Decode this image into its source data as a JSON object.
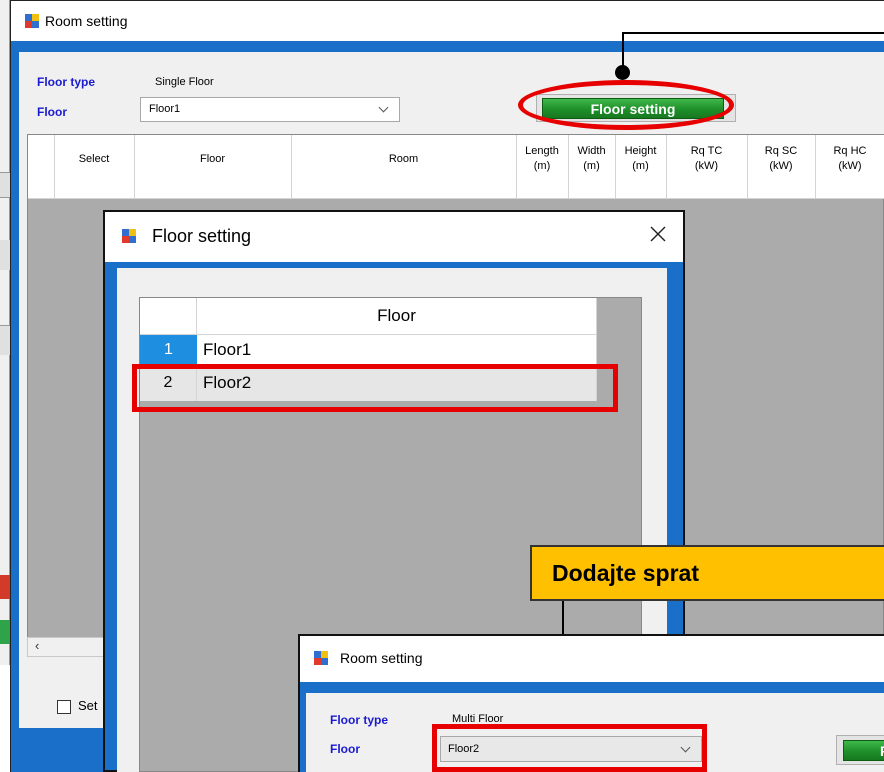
{
  "main_window": {
    "title": "Room setting",
    "floor_type_label": "Floor type",
    "floor_type_value": "Single Floor",
    "floor_label": "Floor",
    "floor_value": "Floor1",
    "floor_setting_button": "Floor setting",
    "columns": [
      {
        "line1": "Select",
        "line2": ""
      },
      {
        "line1": "Floor",
        "line2": ""
      },
      {
        "line1": "Room",
        "line2": ""
      },
      {
        "line1": "Length",
        "line2": "(m)"
      },
      {
        "line1": "Width",
        "line2": "(m)"
      },
      {
        "line1": "Height",
        "line2": "(m)"
      },
      {
        "line1": "Rq TC",
        "line2": "(kW)"
      },
      {
        "line1": "Rq SC",
        "line2": "(kW)"
      },
      {
        "line1": "Rq HC",
        "line2": "(kW)"
      }
    ],
    "checkbox_label": "Set"
  },
  "floor_dialog": {
    "title": "Floor setting",
    "column_header": "Floor",
    "rows": [
      {
        "num": "1",
        "name": "Floor1",
        "selected": true
      },
      {
        "num": "2",
        "name": "Floor2",
        "selected": false
      }
    ]
  },
  "callout": {
    "text": "Dodajte sprat",
    "bg_color": "#ffc000"
  },
  "second_window": {
    "title": "Room setting",
    "floor_type_label": "Floor type",
    "floor_type_value": "Multi Floor",
    "floor_label": "Floor",
    "floor_value": "Floor2",
    "button_partial": "F"
  },
  "colors": {
    "accent_blue": "#1a6fc9",
    "label_blue": "#1a1ad0",
    "button_green": "#1e8f2a",
    "highlight_red": "#e60000",
    "grid_gray": "#ababab"
  }
}
